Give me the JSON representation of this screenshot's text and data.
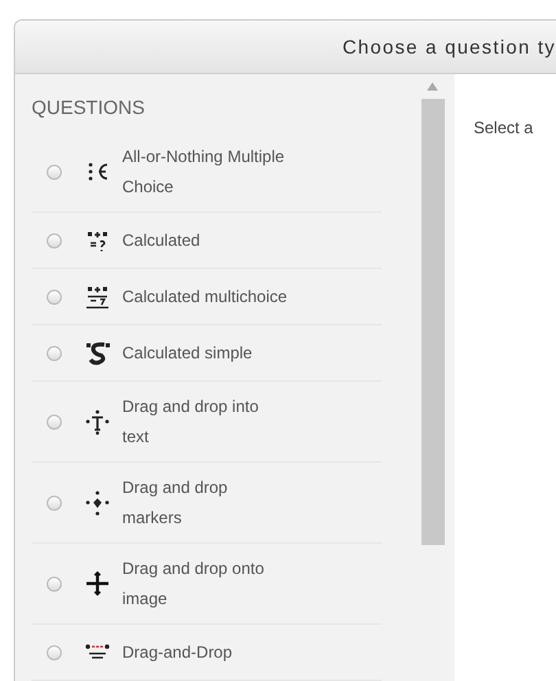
{
  "dialog": {
    "title": "Choose a question ty"
  },
  "questions": {
    "heading": "QUESTIONS",
    "items": [
      {
        "label": "All-or-Nothing Multiple Choice",
        "kind": "element",
        "selected": false
      },
      {
        "label": "Calculated",
        "kind": "calc",
        "selected": false
      },
      {
        "label": "Calculated multichoice",
        "kind": "calcmulti",
        "selected": false
      },
      {
        "label": "Calculated simple",
        "kind": "calcsimple",
        "selected": false
      },
      {
        "label": "Drag and drop into text",
        "kind": "ddtext",
        "selected": false
      },
      {
        "label": "Drag and drop markers",
        "kind": "ddmarker",
        "selected": false
      },
      {
        "label": "Drag and drop onto image",
        "kind": "ddimage",
        "selected": false
      },
      {
        "label": "Drag-and-Drop",
        "kind": "ddmatch",
        "selected": false
      }
    ]
  },
  "details": {
    "text": "Select a"
  }
}
